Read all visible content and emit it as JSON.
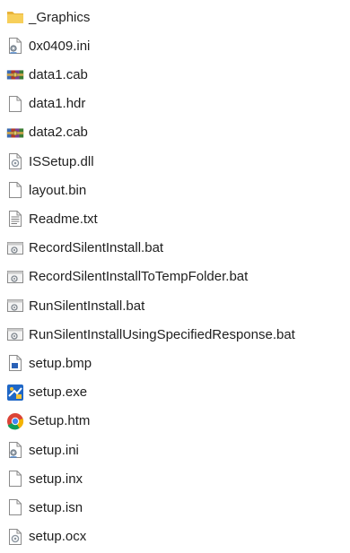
{
  "files": [
    {
      "name": "_Graphics",
      "icon": "folder-icon"
    },
    {
      "name": "0x0409.ini",
      "icon": "settings-file-icon"
    },
    {
      "name": "data1.cab",
      "icon": "cabinet-archive-icon"
    },
    {
      "name": "data1.hdr",
      "icon": "generic-file-icon"
    },
    {
      "name": "data2.cab",
      "icon": "cabinet-archive-icon"
    },
    {
      "name": "ISSetup.dll",
      "icon": "dll-file-icon"
    },
    {
      "name": "layout.bin",
      "icon": "generic-file-icon"
    },
    {
      "name": "Readme.txt",
      "icon": "text-file-icon"
    },
    {
      "name": "RecordSilentInstall.bat",
      "icon": "batch-file-icon"
    },
    {
      "name": "RecordSilentInstallToTempFolder.bat",
      "icon": "batch-file-icon"
    },
    {
      "name": "RunSilentInstall.bat",
      "icon": "batch-file-icon"
    },
    {
      "name": "RunSilentInstallUsingSpecifiedResponse.bat",
      "icon": "batch-file-icon"
    },
    {
      "name": "setup.bmp",
      "icon": "bitmap-image-icon"
    },
    {
      "name": "setup.exe",
      "icon": "installer-exe-icon"
    },
    {
      "name": "Setup.htm",
      "icon": "chrome-html-icon"
    },
    {
      "name": "setup.ini",
      "icon": "settings-file-icon"
    },
    {
      "name": "setup.inx",
      "icon": "generic-file-icon"
    },
    {
      "name": "setup.isn",
      "icon": "generic-file-icon"
    },
    {
      "name": "setup.ocx",
      "icon": "dll-file-icon"
    }
  ]
}
